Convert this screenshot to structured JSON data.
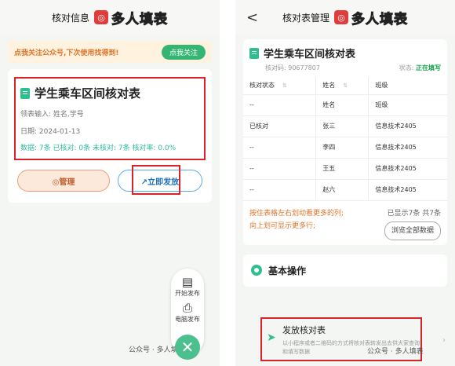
{
  "left": {
    "header_title": "核对信息",
    "logo_text": "多人填表",
    "notice": {
      "text": "点我关注公众号,下次使用找得到!",
      "button": "点我关注"
    },
    "sheet": {
      "title": "学生乘车区间核对表",
      "fields": "领表输入: 姓名,学号",
      "date": "日期: 2024-01-13",
      "stats": "数据: 7条 已核对: 0条 未核对: 7条 核对率: 0.0%"
    },
    "buttons": {
      "manage": "◎管理",
      "publish": "↗立即发放"
    },
    "float_menu": [
      {
        "icon": "start-publish-icon",
        "label": "开始发布"
      },
      {
        "icon": "pc-publish-icon",
        "label": "电脑发布"
      }
    ],
    "watermark": "公众号 · 多人填表"
  },
  "right": {
    "back": "<",
    "header_title": "核对表管理",
    "logo_text": "多人填表",
    "sheet_title": "学生乘车区间核对表",
    "code_label": "核对码: 90677807",
    "status_label": "状态:",
    "status_value": "正在填写",
    "columns": [
      "核对状态",
      "姓名",
      "班级"
    ],
    "rows": [
      [
        "--",
        "姓名",
        "班级"
      ],
      [
        "已核对",
        "张三",
        "信息技术2405"
      ],
      [
        "--",
        "李四",
        "信息技术2405"
      ],
      [
        "--",
        "王五",
        "信息技术2405"
      ],
      [
        "--",
        "赵六",
        "信息技术2405"
      ]
    ],
    "hint_line1": "按住表格左右划动看更多的列;",
    "hint_line2": "向上划可显示更多行;",
    "shown_count": "已显示7条 共7条",
    "browse_all": "浏览全部数据",
    "basic_ops": "基本操作",
    "publish_item": {
      "title": "发放核对表",
      "desc": "以小程序或者二维码的方式将核对表转发出去供大家查询和填写数据"
    },
    "watermark": "公众号 · 多人填表"
  },
  "colors": {
    "accent": "#2fbf8f",
    "annotation": "#d8232a",
    "warning": "#e0742a"
  }
}
